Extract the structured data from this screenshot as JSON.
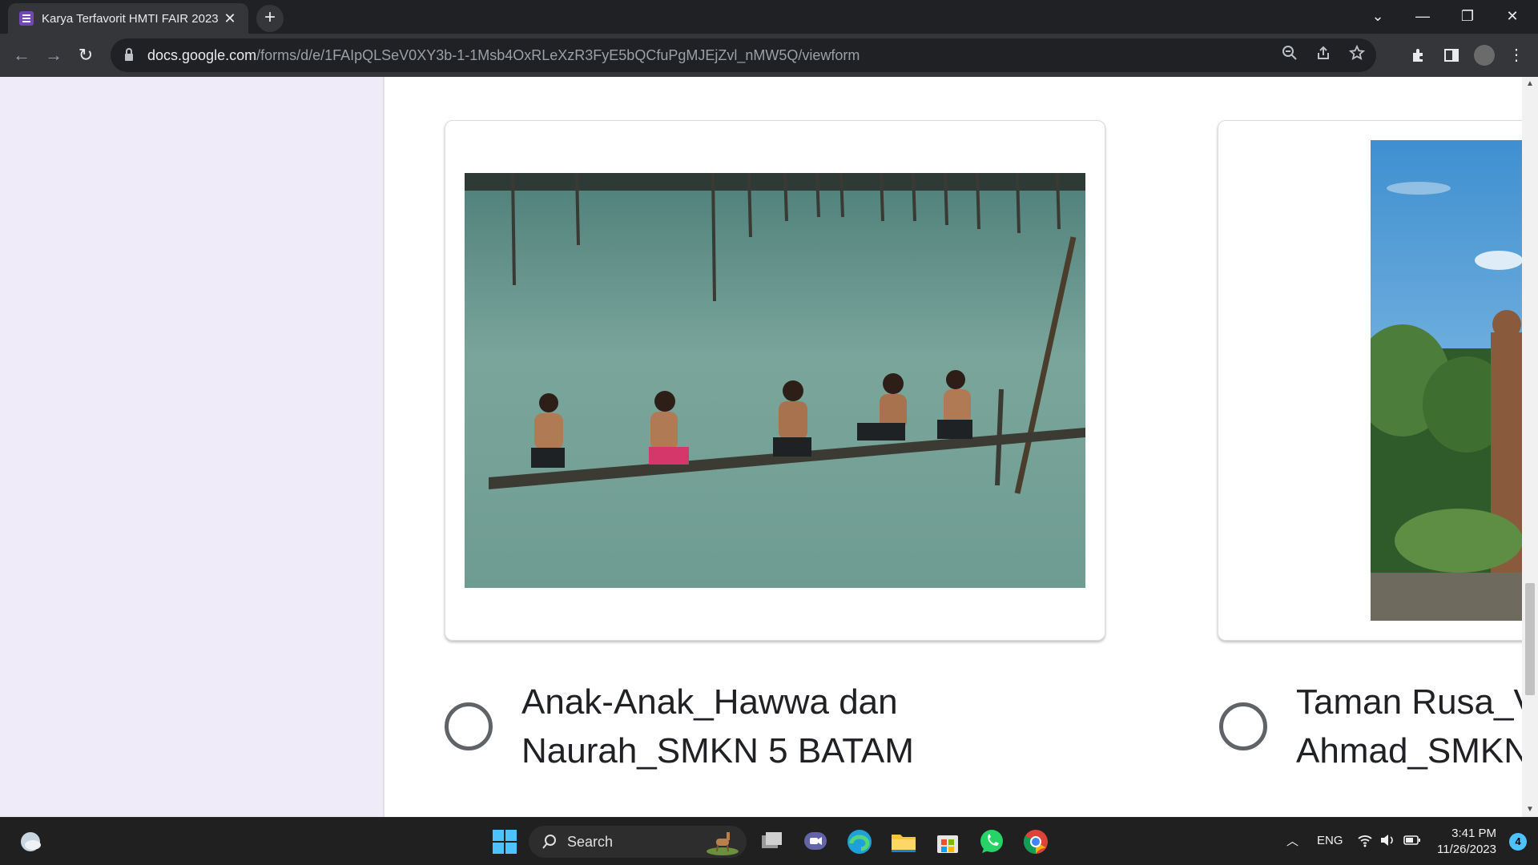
{
  "browser": {
    "tab_title": "Karya Terfavorit HMTI FAIR 2023",
    "tab_close": "✕",
    "new_tab": "+",
    "url_host": "docs.google.com",
    "url_path": "/forms/d/e/1FAIpQLSeV0XY3b-1-1Msb4OxRLeXzR3FyE5bQCfuPgMJEjZvl_nMW5Q/viewform",
    "window_buttons": [
      "⌄",
      "—",
      "❐",
      "✕"
    ]
  },
  "form": {
    "options": [
      {
        "label": "Anak-Anak_Hawwa dan\nNaurah_SMKN 5 BATAM"
      },
      {
        "label": "Taman Rusa_V\nAhmad_SMKN"
      }
    ]
  },
  "taskbar": {
    "search_label": "Search",
    "language": "ENG",
    "time": "3:41 PM",
    "date": "11/26/2023",
    "notification_count": "4"
  },
  "colors": {
    "accent": "#7248b9",
    "page_background": "#f0ebf8",
    "taskbar": "#202020"
  }
}
